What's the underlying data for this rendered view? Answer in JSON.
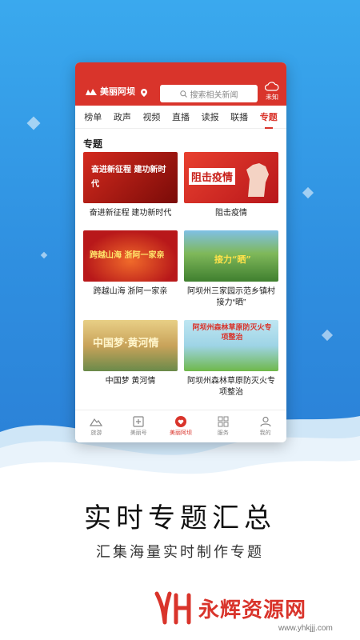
{
  "app": {
    "logo_text": "美丽阿坝",
    "search_placeholder": "搜索相关新闻",
    "weather_label": "未知"
  },
  "tabs": [
    "榜单",
    "政声",
    "视频",
    "直播",
    "读报",
    "联播",
    "专题"
  ],
  "active_tab": "专题",
  "section_title": "专题",
  "cards": [
    {
      "caption": "奋进新征程 建功新时代",
      "overlay": "奋进新征程  建功新时代",
      "color1": "#c81f1a",
      "color2": "#7a0b08"
    },
    {
      "caption": "阻击疫情",
      "overlay": "阻击疫情",
      "color1": "#e0342a",
      "color2": "#b8161a"
    },
    {
      "caption": "跨越山海 浙阿一家亲",
      "overlay": "跨越山海 浙阿一家亲",
      "color1": "#d4221c",
      "color2": "#8e1410"
    },
    {
      "caption": "阿坝州三家园示范乡镇村接力“晒”",
      "overlay": "接力“晒”",
      "color1": "#5a9a3a",
      "color2": "#2f6a2a"
    },
    {
      "caption": "中国梦 黄河情",
      "overlay": "中国梦·黄河情",
      "color1": "#d8b060",
      "color2": "#8a6a3a"
    },
    {
      "caption": "阿坝州森林草原防灭火专项整治",
      "overlay": "阿坝州森林草原防灭火专项整治",
      "color1": "#a8d8e8",
      "color2": "#6fb84a"
    }
  ],
  "nav": [
    {
      "label": "旅游",
      "icon": "mountain-icon"
    },
    {
      "label": "美丽号",
      "icon": "plus-square-icon"
    },
    {
      "label": "美丽阿坝",
      "icon": "heart-icon"
    },
    {
      "label": "服务",
      "icon": "grid-icon"
    },
    {
      "label": "我的",
      "icon": "user-icon"
    }
  ],
  "active_nav": "美丽阿坝",
  "slogan_title": "实时专题汇总",
  "slogan_subtitle": "汇集海量实时制作专题",
  "brand": {
    "name": "永辉资源网",
    "url": "www.yhkjjj.com",
    "color": "#d9342b"
  },
  "colors": {
    "accent": "#d9342b",
    "background": "#3aa9ee"
  }
}
